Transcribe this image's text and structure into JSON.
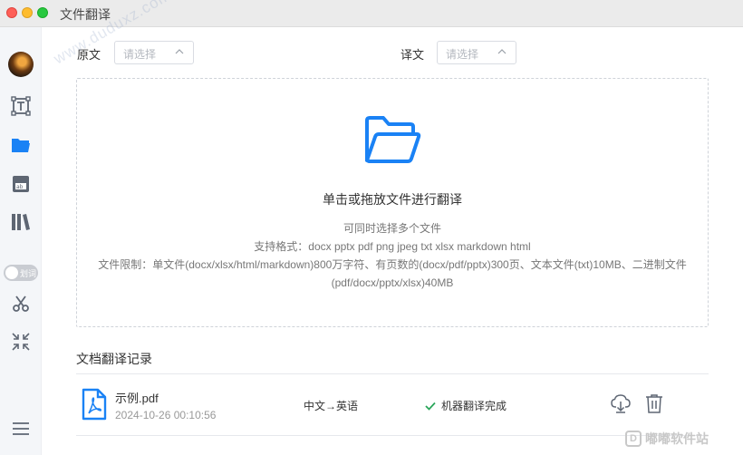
{
  "window": {
    "title": "文件翻译"
  },
  "sidebar": {
    "toggle_label": "划词",
    "items": [
      {
        "name": "text-translate",
        "icon": "text-box-icon"
      },
      {
        "name": "file-translate",
        "icon": "folder-icon",
        "active": true
      },
      {
        "name": "image-translate",
        "icon": "ab-image-icon"
      },
      {
        "name": "library",
        "icon": "books-icon"
      },
      {
        "name": "screenshot",
        "icon": "scissors-icon"
      },
      {
        "name": "collapse",
        "icon": "shrink-arrows-icon"
      },
      {
        "name": "menu",
        "icon": "hamburger-menu-icon"
      }
    ]
  },
  "languages": {
    "source_label": "原文",
    "source_placeholder": "请选择",
    "target_label": "译文",
    "target_placeholder": "请选择"
  },
  "dropzone": {
    "title": "单击或拖放文件进行翻译",
    "line1": "可同时选择多个文件",
    "line2": "支持格式：docx pptx pdf png jpeg txt xlsx markdown html",
    "line3": "文件限制：单文件(docx/xlsx/html/markdown)800万字符、有页数的(docx/pdf/pptx)300页、文本文件(txt)10MB、二进制文件",
    "line4": "(pdf/docx/pptx/xlsx)40MB"
  },
  "records": {
    "title": "文档翻译记录",
    "items": [
      {
        "name": "示例.pdf",
        "time": "2024-10-26 00:10:56",
        "direction": "中文→英语",
        "status": "机器翻译完成"
      }
    ]
  },
  "overlay": {
    "watermark": "www.duduxz.com",
    "brand": "嘟嘟软件站",
    "brand_mark": "D"
  },
  "colors": {
    "accent": "#1a82f5",
    "success": "#2aa65a",
    "sidebar_bg": "#f4f6f9"
  }
}
